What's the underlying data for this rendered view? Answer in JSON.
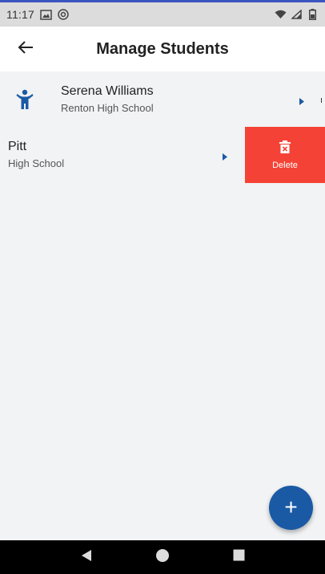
{
  "status_bar": {
    "time": "11:17",
    "left_icons": [
      "image-icon",
      "at-sign-icon"
    ],
    "right_icons": [
      "wifi-icon",
      "signal-icon",
      "battery-icon"
    ]
  },
  "header": {
    "title": "Manage Students",
    "back_icon": "arrow-left-icon"
  },
  "students": [
    {
      "name": "Serena Williams",
      "school": "Renton High School",
      "icon": "child-person-icon"
    },
    {
      "name": "Pitt",
      "school": "High School",
      "swiped": true
    }
  ],
  "swipe_action": {
    "label": "Delete",
    "icon": "trash-icon"
  },
  "fab": {
    "label": "+",
    "icon": "plus-icon"
  },
  "nav_bar": {
    "buttons": [
      "back-triangle-icon",
      "home-circle-icon",
      "recents-square-icon"
    ]
  },
  "colors": {
    "accent": "#1a5aa5",
    "delete": "#f44336",
    "background": "#f1f3f4",
    "status_bar": "#dcdcdc"
  }
}
